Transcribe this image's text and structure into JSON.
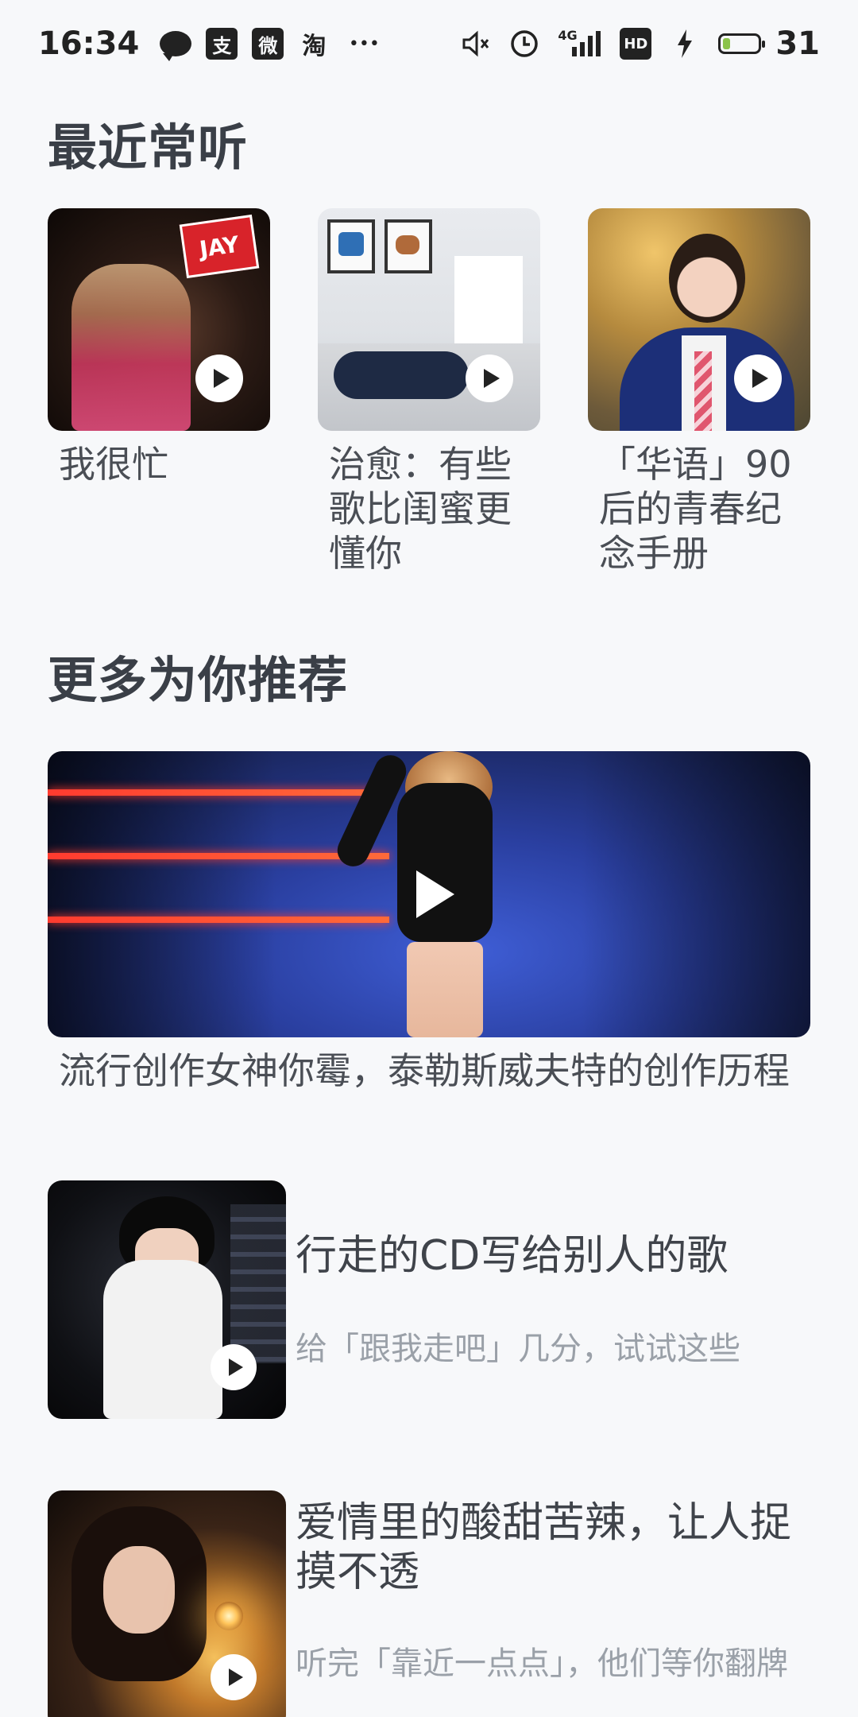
{
  "status_bar": {
    "time": "16:34",
    "icons_left": [
      "message-icon",
      "alipay-icon",
      "weibo-icon",
      "taobao-icon",
      "more-dots-icon"
    ],
    "alipay_glyph": "支",
    "weibo_glyph": "微",
    "taobao_glyph": "淘",
    "more_glyph": "•••",
    "icons_right": [
      "mute-icon",
      "alarm-icon",
      "signal-4g-icon",
      "hd-icon",
      "charging-icon",
      "battery-icon"
    ],
    "signal_label": "4G",
    "hd_label": "HD",
    "battery_level": "31"
  },
  "recent": {
    "heading": "最近常听",
    "albums": [
      {
        "title": "我很忙",
        "badge": "JAY"
      },
      {
        "title": "治愈：有些歌比闺蜜更懂你"
      },
      {
        "title": "「华语」90后的青春纪念手册"
      }
    ]
  },
  "recommend": {
    "heading": "更多为你推荐",
    "feature": {
      "title": "流行创作女神你霉，泰勒斯威夫特的创作历程"
    },
    "items": [
      {
        "title": "行走的CD写给别人的歌",
        "subtitle": "给「跟我走吧」几分，试试这些"
      },
      {
        "title": "爱情里的酸甜苦辣，让人捉摸不透",
        "subtitle": "听完「靠近一点点」，他们等你翻牌"
      }
    ]
  },
  "colors": {
    "background": "#f7f8fa",
    "heading": "#3a3f47",
    "text": "#4a4e55",
    "subtext": "#9aa0a8",
    "battery_fill": "#8bc34a"
  }
}
